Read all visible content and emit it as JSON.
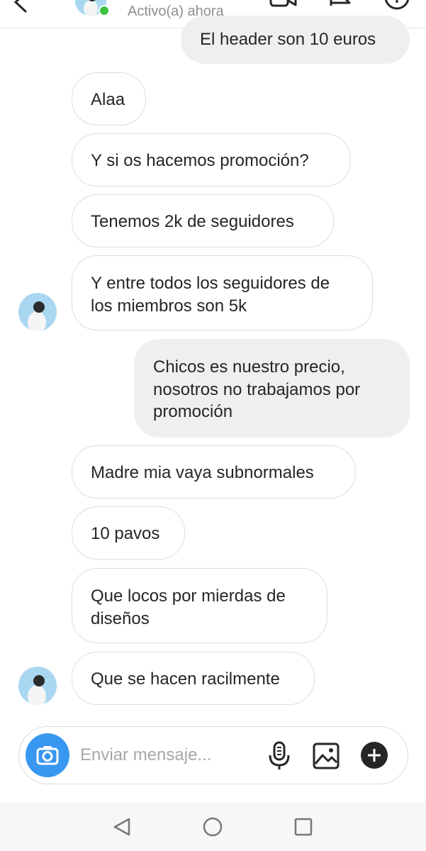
{
  "header": {
    "status": "Activo(a) ahora",
    "online_color": "#3ec33e",
    "icons": [
      "back-arrow-icon",
      "video-call-icon",
      "flag-icon",
      "info-icon"
    ]
  },
  "messages": [
    {
      "direction": "out",
      "text": "El header son 10 euros"
    },
    {
      "direction": "in",
      "text": "Alaa"
    },
    {
      "direction": "in",
      "text": "Y si os hacemos promoción?"
    },
    {
      "direction": "in",
      "text": "Tenemos 2k de seguidores"
    },
    {
      "direction": "in",
      "lines": [
        "Y entre todos los seguidores de",
        "los miembros son 5k"
      ],
      "avatar": true
    },
    {
      "direction": "out",
      "lines": [
        "Chicos es nuestro precio,",
        "nosotros no trabajamos por",
        "promoción"
      ]
    },
    {
      "direction": "in",
      "text": "Madre mia vaya subnormales"
    },
    {
      "direction": "in",
      "text": "10 pavos"
    },
    {
      "direction": "in",
      "lines": [
        "Que locos por mierdas de",
        "diseños"
      ]
    },
    {
      "direction": "in",
      "text": "Que se hacen racilmente",
      "avatar": true
    }
  ],
  "composer": {
    "placeholder": "Enviar mensaje...",
    "camera_color": "#3897f0",
    "icons": [
      "camera-icon",
      "microphone-icon",
      "gallery-icon",
      "plus-icon"
    ]
  },
  "navbar": {
    "icons": [
      "nav-back-icon",
      "nav-home-icon",
      "nav-recents-icon"
    ]
  },
  "colors": {
    "incoming_border": "#dedede",
    "outgoing_bg": "#efefef",
    "text": "#262626",
    "muted": "#8e8e8e"
  }
}
